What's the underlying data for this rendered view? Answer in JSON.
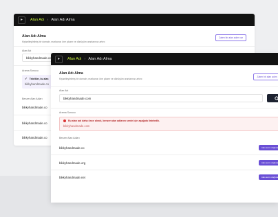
{
  "back_window": {
    "titlebar": {
      "crumb_primary": "Alan Adı",
      "crumb_secondary": "Alan Adı Alma"
    },
    "header": {
      "title": "Alan Adı Alma",
      "subtitle": "Kişiselleştirilmiş bir domain, markanızı öne çıkarır ve dönüşüm oranlarınızı artırır."
    },
    "existing_button_label": "Zaten bir alan adım var",
    "domain_label": "Alan Adı",
    "domain_value": "bikkyhandmade.co",
    "search_result_label": "Arama Sonucu",
    "success_message": "Tebrikler, bu alan",
    "success_domain": "bikkyhandmade.co",
    "similar_label": "Benzer Alan Adları",
    "similar": [
      "bikkyhandmade.co",
      "bikkyhandmade.co",
      "bikkyhandmade.co"
    ]
  },
  "front_window": {
    "titlebar": {
      "crumb_primary": "Alan Adı",
      "crumb_secondary": "Alan Adı Alma"
    },
    "header": {
      "title": "Alan Adı Alma",
      "subtitle": "Kişiselleştirilmiş bir domain, markanızı öne çıkarır ve dönüşüm oranlarınızı artırır."
    },
    "existing_button_label": "Zaten bir alan adım",
    "domain_label": "Alan Adı",
    "domain_value": "bikkyhandmade.com",
    "search_result_label": "Arama Sonucu",
    "error_message": "Bu alan adı daha önce alındı, benzer alan adlarını senin için aşağıda listeledik.",
    "error_domain": "bikkyhandmade.com",
    "similar_label": "Benzer Alan Adları",
    "similar": [
      {
        "domain": "bikkyhandmade.co",
        "action": "Alan adını doğrula"
      },
      {
        "domain": "bikkyhandmade.org",
        "action": "Alan adını doğrula"
      },
      {
        "domain": "bikkyhandmade.net",
        "action": "Alan adını doğrula"
      }
    ]
  },
  "colors": {
    "accent": "#6a4fd6",
    "brand_green": "#c8f23e",
    "titlebar": "#121212",
    "error": "#d33333"
  }
}
